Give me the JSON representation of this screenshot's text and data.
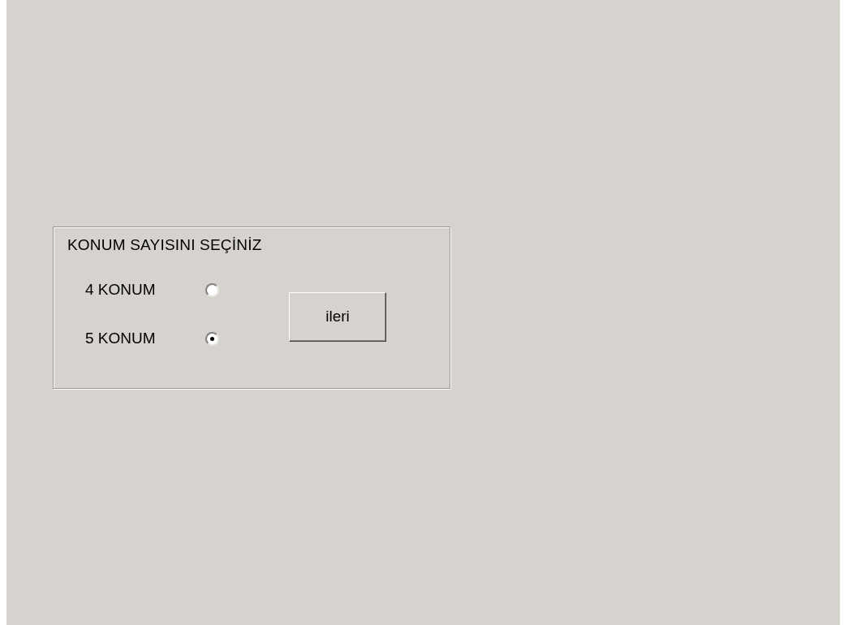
{
  "group": {
    "title": "KONUM SAYISINI SEÇİNİZ",
    "options": [
      {
        "label": "4 KONUM",
        "selected": false
      },
      {
        "label": "5 KONUM",
        "selected": true
      }
    ],
    "button": "ileri"
  }
}
